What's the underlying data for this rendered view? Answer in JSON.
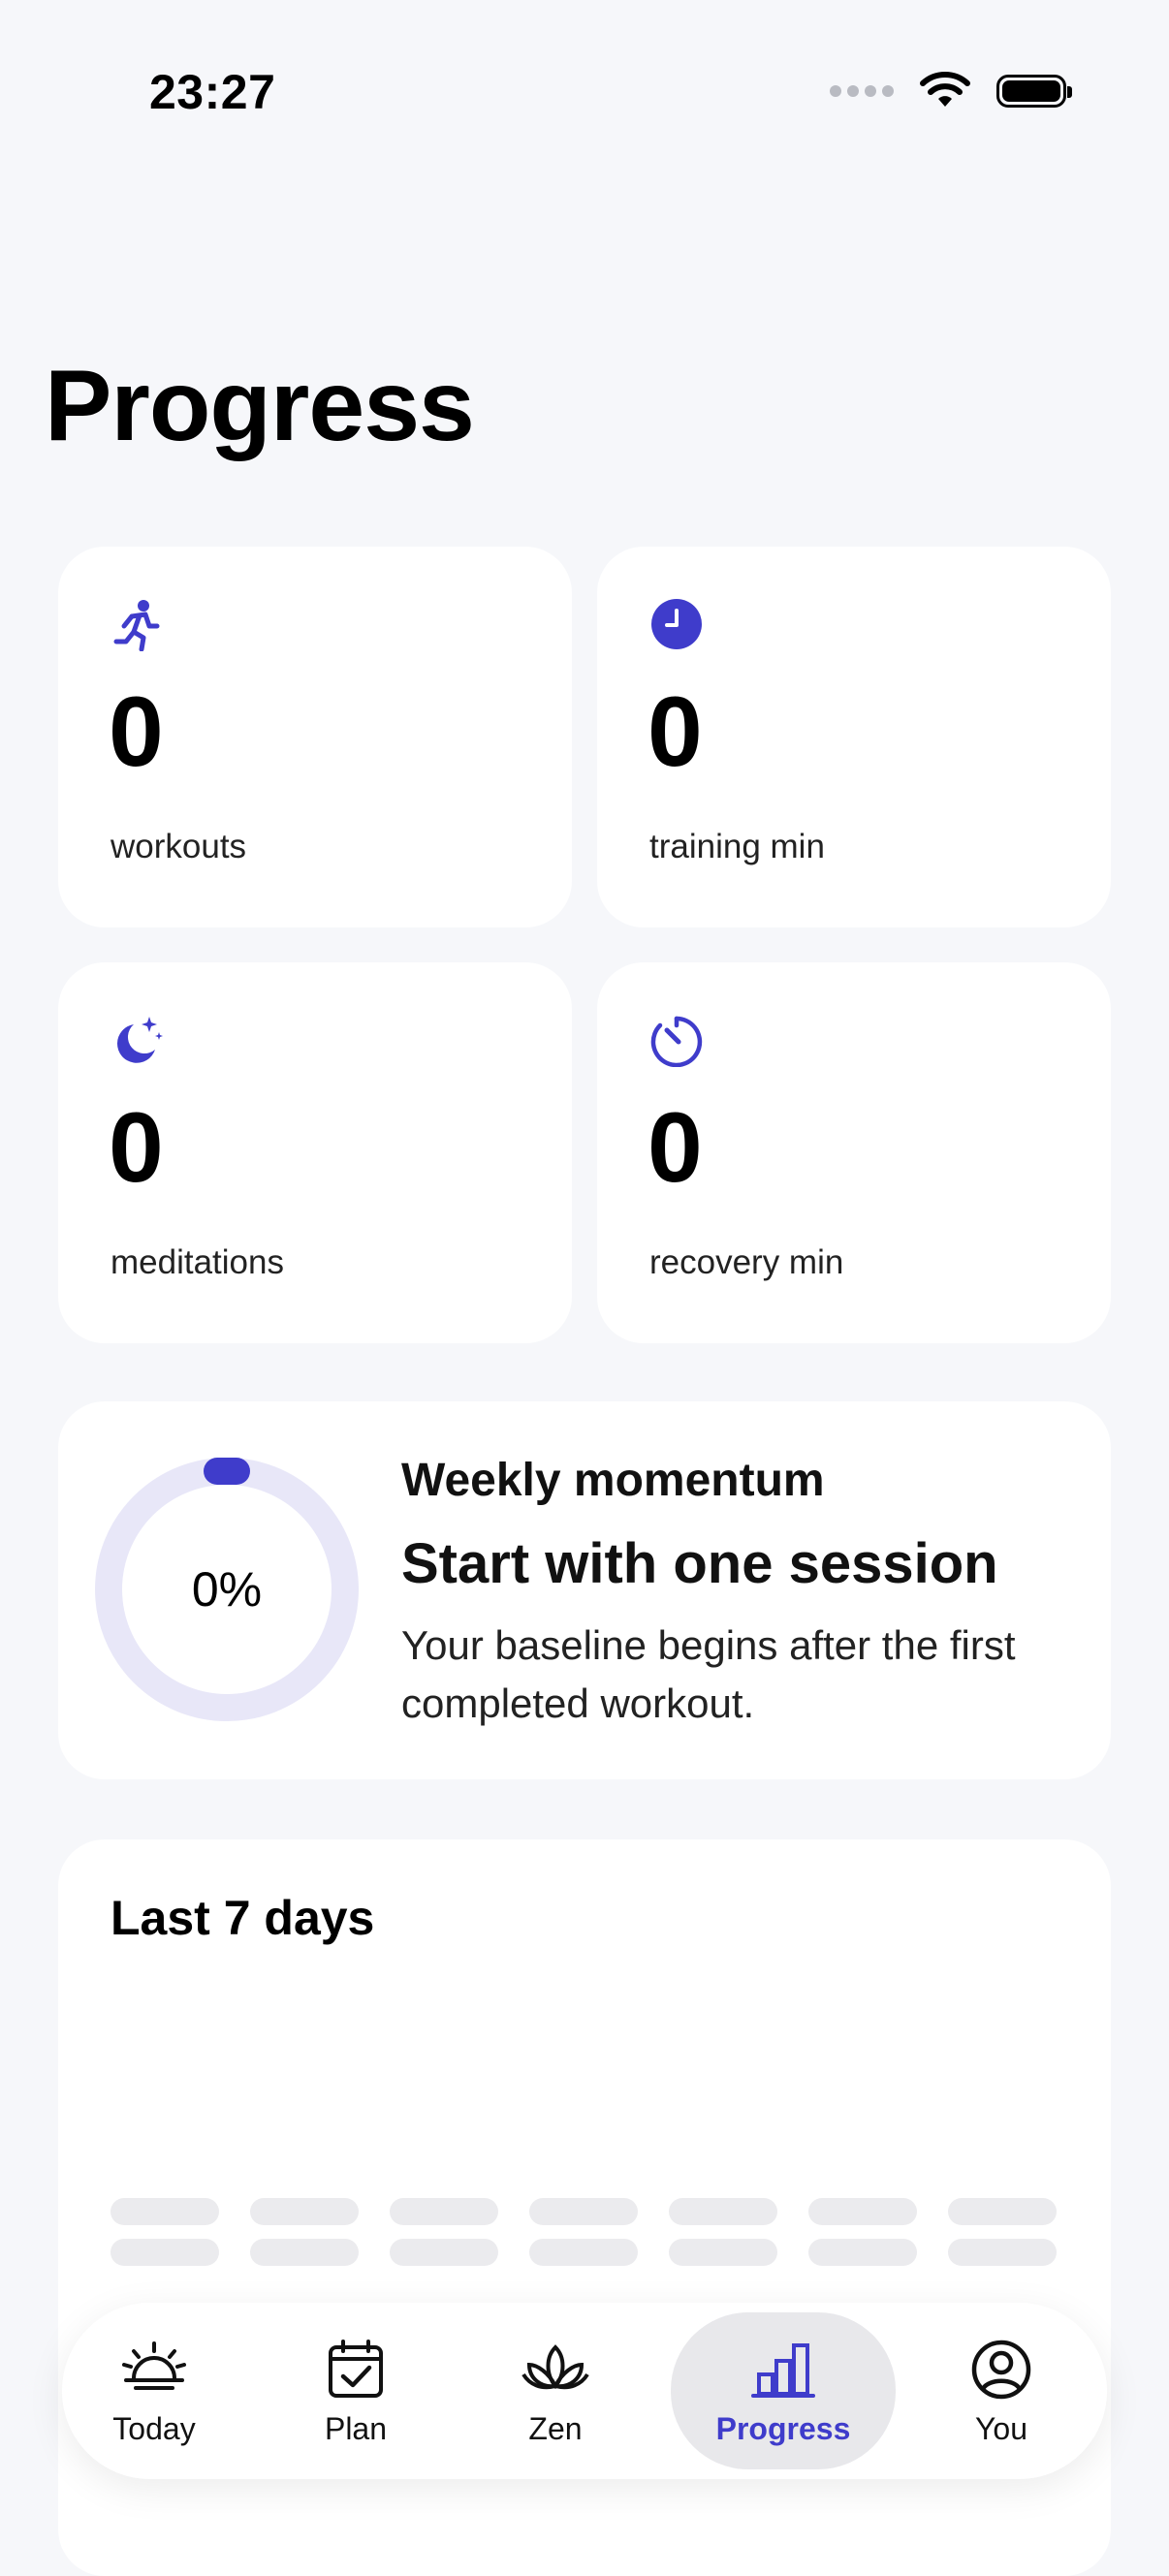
{
  "status_bar": {
    "time": "23:27"
  },
  "page": {
    "title": "Progress"
  },
  "stats": [
    {
      "icon": "running-person-icon",
      "value": "0",
      "label": "workouts"
    },
    {
      "icon": "clock-icon",
      "value": "0",
      "label": "training min"
    },
    {
      "icon": "moon-stars-icon",
      "value": "0",
      "label": "meditations"
    },
    {
      "icon": "timer-icon",
      "value": "0",
      "label": "recovery min"
    }
  ],
  "momentum": {
    "heading": "Weekly momentum",
    "percent_label": "0%",
    "percent": 0,
    "title": "Start with one session",
    "description": "Your baseline begins after the first completed workout."
  },
  "last7": {
    "title": "Last 7 days",
    "days_count": 7
  },
  "tabs": [
    {
      "label": "Today",
      "icon": "sunrise-icon",
      "active": false
    },
    {
      "label": "Plan",
      "icon": "calendar-check-icon",
      "active": false
    },
    {
      "label": "Zen",
      "icon": "lotus-icon",
      "active": false
    },
    {
      "label": "Progress",
      "icon": "bar-chart-icon",
      "active": true
    },
    {
      "label": "You",
      "icon": "person-circle-icon",
      "active": false
    }
  ],
  "colors": {
    "accent": "#3F3CCB",
    "ring_track": "#E8E7F8",
    "background": "#F6F7FA"
  }
}
